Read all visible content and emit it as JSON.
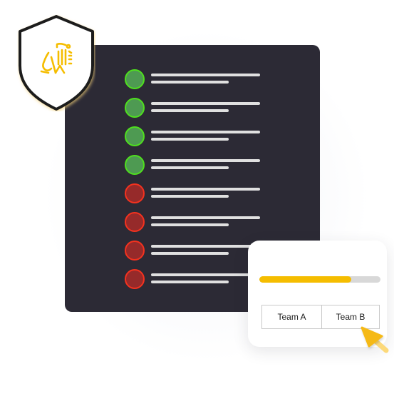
{
  "illustration": {
    "shield": {
      "logo_icon": "lion-logo-icon",
      "logo_color": "#f5bd00",
      "outline_color": "#1c1c1c"
    },
    "status_list": {
      "items": [
        {
          "status": "ok"
        },
        {
          "status": "ok"
        },
        {
          "status": "ok"
        },
        {
          "status": "ok"
        },
        {
          "status": "error"
        },
        {
          "status": "error"
        },
        {
          "status": "error"
        },
        {
          "status": "error"
        }
      ],
      "colors": {
        "ok_fill": "#4e9a52",
        "ok_border": "#4fe01e",
        "error_fill": "#962a2a",
        "error_border": "#f4321f",
        "panel": "#2c2a35"
      }
    },
    "vote_card": {
      "progress_percent": 76,
      "progress_color": "#f5bd00",
      "teams": [
        "Team A",
        "Team B"
      ],
      "cursor_icon": "pointer-cursor-icon",
      "cursor_color": "#f5bd00"
    }
  }
}
